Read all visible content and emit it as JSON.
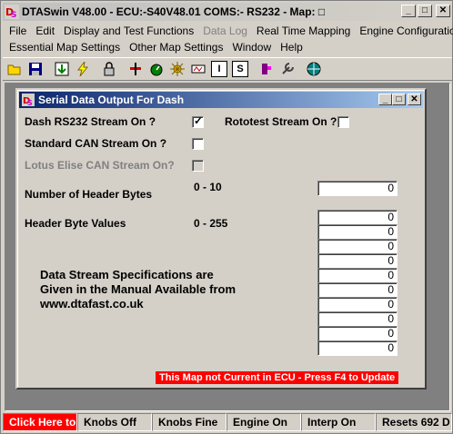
{
  "app": {
    "title": "DTASwin V48.00 - ECU:-S40V48.01 COMS:- RS232 - Map: □"
  },
  "window_buttons": {
    "minimize": "_",
    "maximize": "□",
    "close": "✕"
  },
  "menu_row1": [
    "File",
    "Edit",
    "Display and Test Functions",
    "Data Log",
    "Real Time Mapping",
    "Engine Configuration"
  ],
  "menu_row2": [
    "Essential Map Settings",
    "Other Map Settings",
    "Window",
    "Help"
  ],
  "toolbar": {
    "icons": [
      "open-icon",
      "save-icon",
      "download-icon",
      "lightning-icon",
      "lock-icon",
      "map-icon",
      "tacho-icon",
      "sparkle-icon",
      "ignition-icon",
      "i-icon",
      "s-icon",
      "puzzle-icon",
      "wrench-icon",
      "globe-icon"
    ],
    "i_label": "I",
    "s_label": "S"
  },
  "dialog": {
    "title": "Serial Data Output For Dash",
    "dash_rs232_label": "Dash RS232 Stream On ?",
    "dash_rs232_checked": true,
    "rototest_label": "Rototest Stream On ?",
    "rototest_checked": false,
    "standard_can_label": "Standard CAN Stream On ?",
    "standard_can_checked": false,
    "lotus_can_label": "Lotus Elise CAN Stream On?",
    "lotus_can_checked": false,
    "num_header_label": "Number of Header Bytes",
    "num_header_range": "0 - 10",
    "num_header_value": "0",
    "header_values_label": "Header Byte Values",
    "header_values_range": "0 - 255",
    "header_values": [
      "0",
      "0",
      "0",
      "0",
      "0",
      "0",
      "0",
      "0",
      "0",
      "0"
    ],
    "info_line1": "Data Stream Specifications are",
    "info_line2": "Given in the Manual Available from",
    "info_line3": "www.dtafast.co.uk",
    "warning": "This Map not Current in ECU - Press F4 to Update"
  },
  "statusbar": {
    "click_here": "Click Here to",
    "knobs_off": "Knobs Off",
    "knobs_fine": "Knobs Fine",
    "engine_on": "Engine On",
    "interp_on": "Interp On",
    "resets": "Resets 692 D"
  }
}
